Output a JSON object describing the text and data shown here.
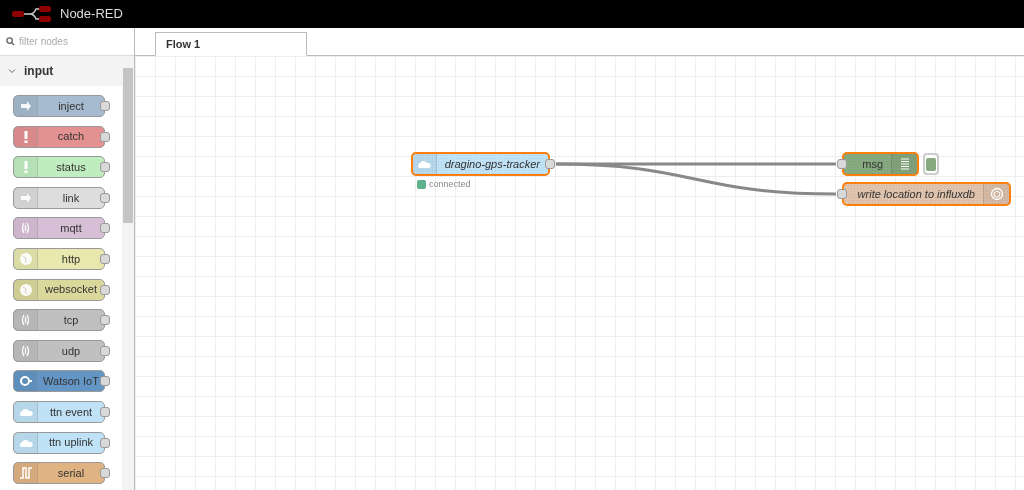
{
  "header": {
    "title": "Node-RED"
  },
  "palette": {
    "filter": {
      "placeholder": "filter nodes"
    },
    "category": {
      "label": "input",
      "expanded": true
    },
    "nodes": [
      {
        "label": "inject",
        "color": "#a6bbcf",
        "kind": "arrow"
      },
      {
        "label": "catch",
        "color": "#e49191",
        "kind": "alert"
      },
      {
        "label": "status",
        "color": "#c0edc0",
        "kind": "alert"
      },
      {
        "label": "link",
        "color": "#dddddd",
        "kind": "arrow"
      },
      {
        "label": "mqtt",
        "color": "#d8bfd8",
        "kind": "wave"
      },
      {
        "label": "http",
        "color": "#e7e7ae",
        "kind": "globe"
      },
      {
        "label": "websocket",
        "color": "#dbd89c",
        "kind": "globe"
      },
      {
        "label": "tcp",
        "color": "#c0c0c0",
        "kind": "wave"
      },
      {
        "label": "udp",
        "color": "#c0c0c0",
        "kind": "wave"
      },
      {
        "label": "Watson IoT",
        "color": "#6496c5",
        "kind": "chip"
      },
      {
        "label": "ttn event",
        "color": "#c0e2f6",
        "kind": "cloud"
      },
      {
        "label": "ttn uplink",
        "color": "#c0e2f6",
        "kind": "cloud"
      },
      {
        "label": "serial",
        "color": "#e0b383",
        "kind": "serial"
      }
    ]
  },
  "tabs": [
    {
      "label": "Flow 1",
      "selected": true
    }
  ],
  "flow": {
    "nodes": [
      {
        "kind": "input",
        "label": "dragino-gps-tracker",
        "color": "#c0e2f6",
        "selected": true,
        "status": {
          "text": "connected",
          "color": "#5fb38c"
        }
      },
      {
        "kind": "debug",
        "label": "msg",
        "color": "#87a980",
        "selected": true,
        "active": true
      },
      {
        "kind": "output",
        "label": "write location to influxdb",
        "color": "#dfc3ad",
        "selected": true
      }
    ]
  }
}
